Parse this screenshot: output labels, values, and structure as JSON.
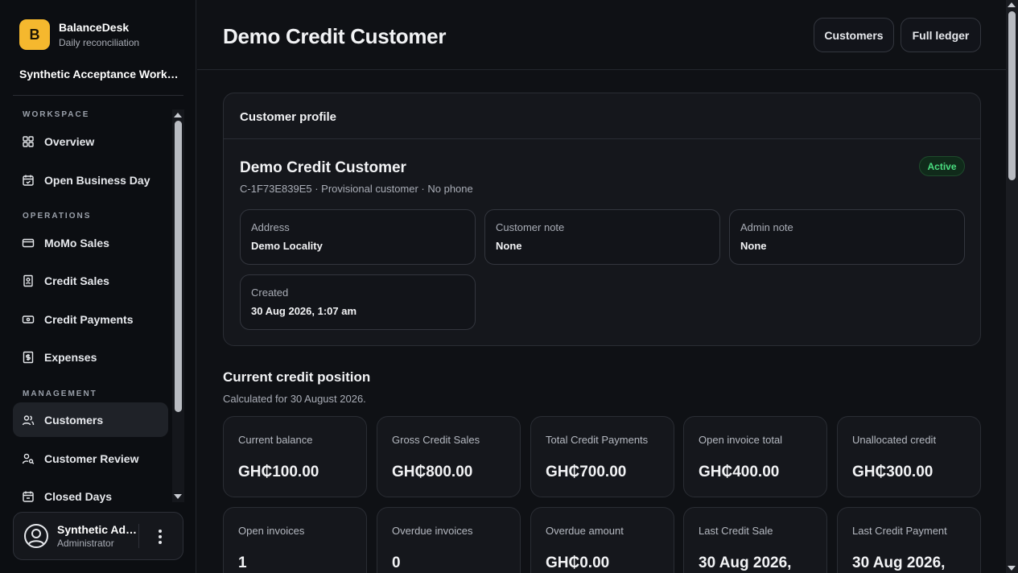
{
  "brand": {
    "logo_letter": "B",
    "name": "BalanceDesk",
    "subtitle": "Daily reconciliation",
    "color": "#f5b82e"
  },
  "workspace": {
    "name": "Synthetic Acceptance Workspace"
  },
  "sidebar": {
    "sections": [
      {
        "title": "WORKSPACE"
      },
      {
        "title": "OPERATIONS"
      },
      {
        "title": "MANAGEMENT"
      }
    ],
    "items": [
      {
        "label": "Overview",
        "icon": "grid-icon"
      },
      {
        "label": "Open Business Day",
        "icon": "calendar-check-icon"
      },
      {
        "label": "MoMo Sales",
        "icon": "credit-card-icon"
      },
      {
        "label": "Credit Sales",
        "icon": "receipt-icon"
      },
      {
        "label": "Credit Payments",
        "icon": "banknote-icon"
      },
      {
        "label": "Expenses",
        "icon": "dollar-receipt-icon"
      },
      {
        "label": "Customers",
        "icon": "users-icon",
        "active": true
      },
      {
        "label": "Customer Review",
        "icon": "user-search-icon"
      },
      {
        "label": "Closed Days",
        "icon": "calendar-icon"
      }
    ]
  },
  "user": {
    "name": "Synthetic Admin",
    "role": "Administrator"
  },
  "header": {
    "title": "Demo Credit Customer",
    "customers_button": "Customers",
    "ledger_button": "Full ledger"
  },
  "profile": {
    "card_title": "Customer profile",
    "name": "Demo Credit Customer",
    "meta": "C-1F73E839E5 · Provisional customer · No phone",
    "status": "Active",
    "status_color": "#4ade80",
    "fields": [
      {
        "label": "Address",
        "value": "Demo Locality"
      },
      {
        "label": "Customer note",
        "value": "None"
      },
      {
        "label": "Admin note",
        "value": "None"
      },
      {
        "label": "Created",
        "value": "30 Aug 2026, 1:07 am"
      }
    ]
  },
  "credit": {
    "title": "Current credit position",
    "subtitle": "Calculated for 30 August 2026.",
    "stats": [
      {
        "label": "Current balance",
        "value": "GH₵100.00"
      },
      {
        "label": "Gross Credit Sales",
        "value": "GH₵800.00"
      },
      {
        "label": "Total Credit Payments",
        "value": "GH₵700.00"
      },
      {
        "label": "Open invoice total",
        "value": "GH₵400.00"
      },
      {
        "label": "Unallocated credit",
        "value": "GH₵300.00"
      },
      {
        "label": "Open invoices",
        "value": "1"
      },
      {
        "label": "Overdue invoices",
        "value": "0"
      },
      {
        "label": "Overdue amount",
        "value": "GH₵0.00"
      },
      {
        "label": "Last Credit Sale",
        "value": "30 Aug 2026,"
      },
      {
        "label": "Last Credit Payment",
        "value": "30 Aug 2026,"
      }
    ]
  }
}
